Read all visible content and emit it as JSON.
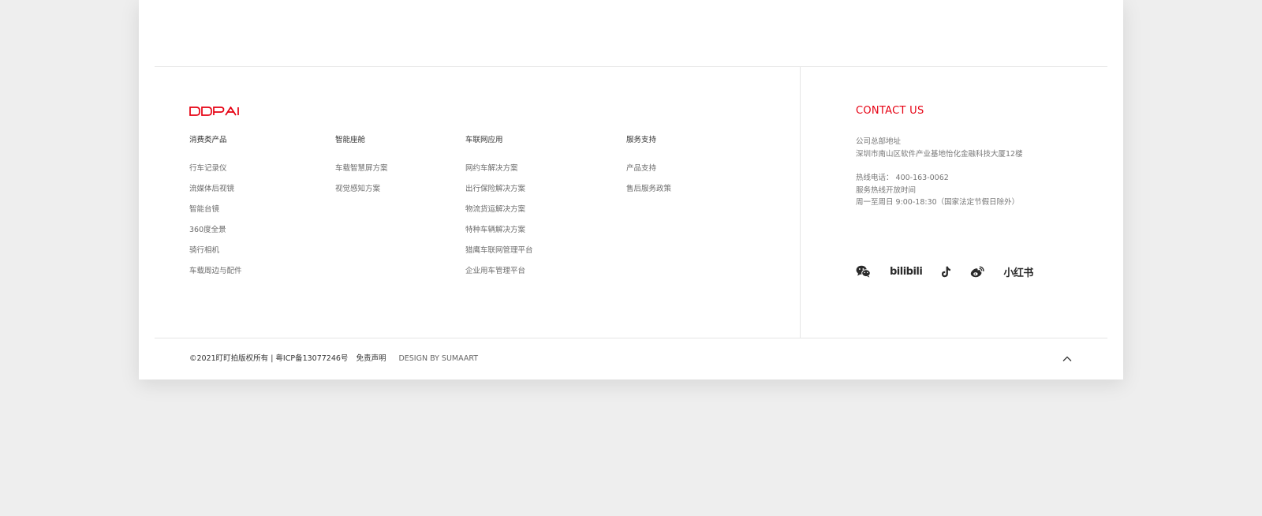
{
  "brand": {
    "logo_text": "DDPAI",
    "accent_color": "#e60012"
  },
  "nav": {
    "columns": [
      {
        "heading": "消费类产品",
        "items": [
          "行车记录仪",
          "流媒体后视镜",
          "智能台镜",
          "360度全景",
          "骑行相机",
          "车载周边与配件"
        ]
      },
      {
        "heading": "智能座舱",
        "items": [
          "车载智慧屏方案",
          "视觉感知方案"
        ]
      },
      {
        "heading": "车联网应用",
        "items": [
          "网约车解决方案",
          "出行保险解决方案",
          "物流货运解决方案",
          "特种车辆解决方案",
          "猎鹰车联网管理平台",
          "企业用车管理平台"
        ]
      },
      {
        "heading": "服务支持",
        "items": [
          "产品支持",
          "售后服务政策"
        ]
      }
    ]
  },
  "contact": {
    "title": "CONTACT US",
    "address_label": "公司总部地址",
    "address": "深圳市南山区软件产业基地怡化金融科技大厦12楼",
    "hotline": "热线电话： 400-163-0062",
    "hours_label": "服务热线开放时间",
    "hours": "周一至周日 9:00-18:30（国家法定节假日除外）"
  },
  "social": {
    "icons": [
      "wechat-icon",
      "bilibili-icon",
      "douyin-icon",
      "weibo-icon",
      "xiaohongshu-icon"
    ],
    "bilibili_text": "bilibili",
    "xiaohongshu_text": "小红书"
  },
  "footer": {
    "copyright": "©2021盯盯拍版权所有 | 粤ICP备13077246号",
    "disclaimer": "免责声明",
    "design_credit": "DESIGN BY SUMAART"
  }
}
